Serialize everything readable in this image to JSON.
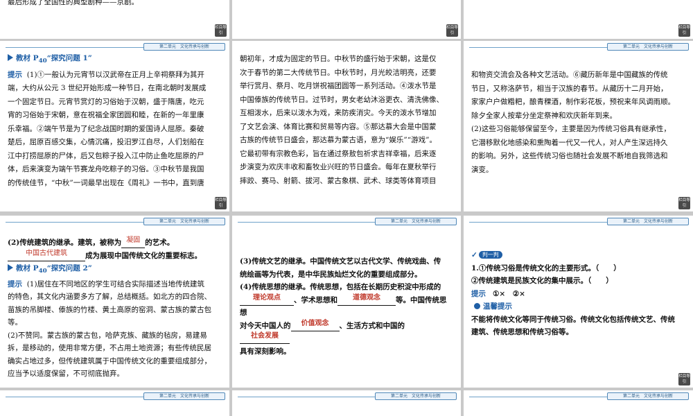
{
  "header_tag": "第二单元　文化传承与创新",
  "nav_label": "栏目导引",
  "s0_0": {
    "line1": "最后形成了全国性的典型剧种——京剧。"
  },
  "s1_0": {
    "title_pre": "教材 P",
    "title_sub": "40",
    "title_post": "“探究问题 1”",
    "hint": "提示",
    "lines": [
      "(1)①一般认为元宵节以汉武帝在正月上辛祠祭拜为其开",
      "端，大约从公元 3 世纪开始形成一种节日，在南北朝时发展成",
      "一个固定节日。元宵节赏灯的习俗始于汉朝，盛于隋唐，吃元",
      "宵的习俗始于宋朝，意在祝福全家团圆和睦，在新的一年里康",
      "乐幸福。②端午节是为了纪念战国时期的爱国诗人屈原。秦破",
      "楚后，屈原百感交集，心情沉痛，投汨罗江自尽，人们划船在",
      "江中打捞屈原的尸体，后又包粽子投入江中防止鱼吃屈原的尸",
      "体，后来演变为端午节赛龙舟吃粽子的习俗。③中秋节是我国",
      "的传统佳节，“中秋”一词最早出现在《周礼》一书中，直到唐"
    ]
  },
  "s1_1": {
    "lines": [
      "朝初年，才成为固定的节日。中秋节的盛行始于宋朝，这是仅",
      "次于春节的第二大传统节日。中秋节时，月光皎洁明亮，还要",
      "举行赏月、祭月、吃月饼祝福团圆等一系列活动。④泼水节是",
      "中国傣族的传统节日。过节时，男女老幼沐浴更衣、清洗佛像、",
      "互相泼水，后来以泼水为戏，来防疾消灾。今天的泼水节增加",
      "了文艺会演、体育比赛和贸易等内容。⑤那达慕大会是中国蒙",
      "古族的传统节日盛会，那达慕为蒙古语，意为“娱乐”“游戏”。",
      "它最初带有宗教色彩，旨在通过祭敖包祈求吉祥幸福，后来逐",
      "步演变为欢庆丰收和畜牧业兴旺的节日盛会。每年在夏秋举行",
      "摔跤、赛马、射箭、拔河、蒙古象棋、武术、球类等体育项目"
    ]
  },
  "s1_2": {
    "lines": [
      "和物资交流会及各种文艺活动。⑥藏历新年是中国藏族的传统",
      "节日，又称洛萨节，相当于汉族的春节。从藏历十二月开始，",
      "家家户户做糌粑，酿青稞酒，制作彩花板，预祝来年风调雨顺。",
      "除夕全家人按辈分坐定祭神和欢庆新年到来。"
    ],
    "lines2": [
      "(2)这些习俗能够保留至今，主要是因为传统习俗具有继承性，",
      "它潜移默化地感染和熏陶着一代又一代人，对人产生深远持久",
      "的影响。另外，这些传统习俗也随社会发展不断地自我筛选和",
      "演变。"
    ]
  },
  "s2_0": {
    "l1_pre": "(2)传统建筑的继承。建筑，被称为",
    "l1_blank": "凝固",
    "l1_post": "的艺术。",
    "l2_blank": "中国古代建筑",
    "l2_post": "成为展现中国传统文化的重要标志。",
    "title_pre": "教材 P",
    "title_sub": "40",
    "title_post": "“探究问题 2”",
    "hint": "提示",
    "lines": [
      "(1)居住在不同地区的学生可结合实际描述当地传统建筑",
      "的特色，其文化内涵要多方了解，总结概括。如北方的四合院、",
      "苗族的吊脚楼、傣族的竹楼、黄土高原的窑洞、蒙古族的蒙古包",
      "等。"
    ],
    "lines2": [
      "(2)不赞同。蒙古族的蒙古包，哈萨克族、藏族的毡房，易建易",
      "拆，是移动的，使用非常方便，不占用土地资源；有些传统民居",
      "确实占地过多，但传统建筑属于中国传统文化的重要组成部分，",
      "应当予以适度保留，不可彻底抛弃。"
    ]
  },
  "s2_1": {
    "lines": [
      "(3)传统文艺的继承。中国传统文艺以古代文学、传统戏曲、传",
      "统绘画等为代表，是中华民族灿烂文化的重要组成部分。",
      "(4)传统思想的继承。传统思想，包括在长期历史积淀中形成的"
    ],
    "b1": "理论观点",
    "m1": "、学术思想和",
    "b2": "道德观念",
    "m2": "等。中国传统思想",
    "m3": "对今天中国人的",
    "b3": "价值观念",
    "m4": "、生活方式和中国的",
    "b4": "社会发展",
    "last": "具有深刻影响。"
  },
  "s2_2": {
    "pill": "判一判",
    "q1": "1.①传统习俗是传统文化的主要形式。（　　）",
    "q2": "②传统建筑是民族文化的集中展示。（　　）",
    "hint": "提示",
    "answer": "①×　②×",
    "tip_title": "温馨提示",
    "tip_lines": [
      "不能将传统文化等同于传统习俗。传统文化包括传统文艺、传统",
      "建筑、传统思想和传统习俗等。"
    ]
  }
}
